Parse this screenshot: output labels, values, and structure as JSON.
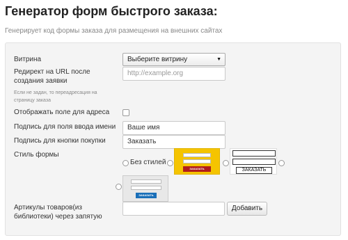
{
  "header": {
    "title": "Генератор форм быстрого заказа:",
    "subtitle": "Генерирует код формы заказа для размещения на внешних сайтах"
  },
  "form": {
    "showcase": {
      "label": "Витрина",
      "value": "Выберите витрину"
    },
    "redirect": {
      "label_line1": "Редирект на URL после",
      "label_line2": "создания заявки",
      "placeholder": "http://example.org",
      "hint_line1": "Если не задан, то переадресация на",
      "hint_line2": "страницу заказа"
    },
    "address": {
      "label": "Отображать поле для адреса",
      "checked": false
    },
    "name_label": {
      "label": "Подпись для поля ввода имени",
      "value": "Ваше имя"
    },
    "button_label": {
      "label": "Подпись для кнопки покупки",
      "value": "Заказать"
    },
    "form_style": {
      "label": "Стиль формы",
      "none_label": "Без стилей",
      "yellow_preview": {
        "button": "ЗАКАЗАТЬ",
        "bg_color": "#f5c400",
        "button_color": "#b01c1c"
      },
      "outline_preview": {
        "button": "ЗАКАЗАТЬ"
      },
      "blue_preview": {
        "button": "ЗАКАЗАТЬ",
        "bg_color": "#e8e8e8",
        "button_color": "#1a6fb8"
      }
    },
    "articles": {
      "label_line1": "Артикулы товаров(из",
      "label_line2": "библиотеки) через запятую",
      "value": "",
      "add_button": "Добавить"
    }
  }
}
